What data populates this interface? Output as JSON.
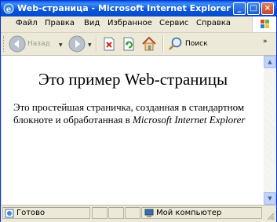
{
  "window": {
    "title": "Web-страница - Microsoft Internet Explorer",
    "controls": {
      "minimize": "_",
      "maximize": "□",
      "close": "×"
    }
  },
  "menu": {
    "items": [
      "Файл",
      "Правка",
      "Вид",
      "Избранное",
      "Сервис",
      "Справка"
    ]
  },
  "toolbar": {
    "back_label": "Назад",
    "search_label": "Поиск"
  },
  "page": {
    "heading": "Это пример Web-страницы",
    "body_text": "Это простейшая страничка, созданная в стандартном блокноте и обработанная в",
    "body_italic": "Microsoft Internet Explorer"
  },
  "status": {
    "left_text": "Готово",
    "zone_text": "Мой компьютер"
  },
  "colors": {
    "titlebar": "#0A5BE5",
    "chrome": "#ECE9D8",
    "content_bg": "#FFFFFF"
  }
}
